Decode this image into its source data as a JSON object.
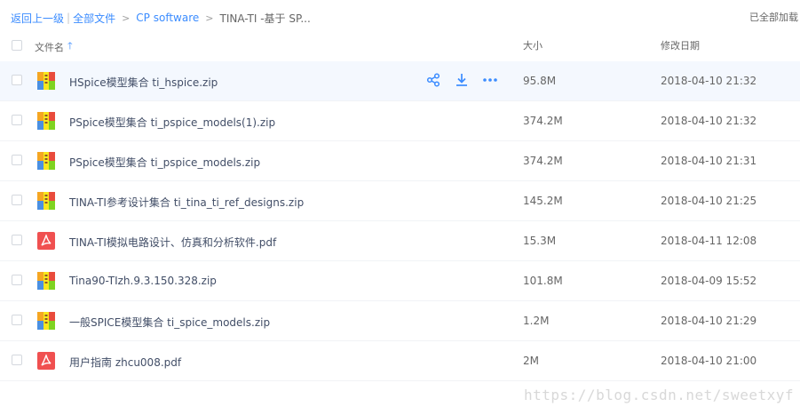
{
  "breadcrumb": {
    "back": "返回上一级",
    "all_files": "全部文件",
    "folder": "CP software",
    "current": "TINA-TI -基于 SP..."
  },
  "loaded_status": "已全部加载",
  "header": {
    "name": "文件名",
    "size": "大小",
    "date": "修改日期"
  },
  "accent_color": "#3b8cff",
  "files": [
    {
      "name": "HSpice模型集合 ti_hspice.zip",
      "size": "95.8M",
      "date": "2018-04-10 21:32",
      "type": "zip-archive-icon"
    },
    {
      "name": "PSpice模型集合 ti_pspice_models(1).zip",
      "size": "374.2M",
      "date": "2018-04-10 21:32",
      "type": "zip-archive-icon"
    },
    {
      "name": "PSpice模型集合 ti_pspice_models.zip",
      "size": "374.2M",
      "date": "2018-04-10 21:31",
      "type": "zip-archive-icon"
    },
    {
      "name": "TINA-TI参考设计集合 ti_tina_ti_ref_designs.zip",
      "size": "145.2M",
      "date": "2018-04-10 21:25",
      "type": "zip-archive-icon"
    },
    {
      "name": "TINA-TI模拟电路设计、仿真和分析软件.pdf",
      "size": "15.3M",
      "date": "2018-04-11 12:08",
      "type": "pdf-icon"
    },
    {
      "name": "Tina90-TIzh.9.3.150.328.zip",
      "size": "101.8M",
      "date": "2018-04-09 15:52",
      "type": "zip-archive-icon"
    },
    {
      "name": "一般SPICE模型集合 ti_spice_models.zip",
      "size": "1.2M",
      "date": "2018-04-10 21:29",
      "type": "zip-archive-icon"
    },
    {
      "name": "用户指南 zhcu008.pdf",
      "size": "2M",
      "date": "2018-04-10 21:00",
      "type": "pdf-icon"
    }
  ],
  "row_actions": [
    "share-icon",
    "download-icon",
    "more-icon"
  ],
  "watermark": "https://blog.csdn.net/sweetxyf"
}
